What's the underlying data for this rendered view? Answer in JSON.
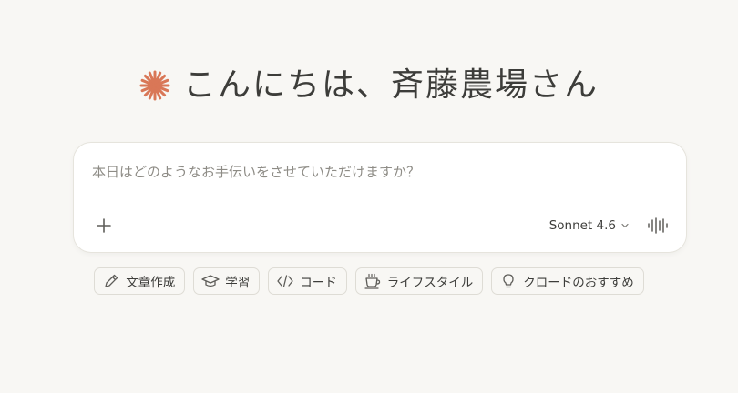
{
  "greeting": {
    "text": "こんにちは、斉藤農場さん",
    "logo_color": "#d97757"
  },
  "composer": {
    "placeholder": "本日はどのようなお手伝いをさせていただけますか？",
    "add_icon": "plus-icon",
    "model_label": "Sonnet 4.6",
    "model_icon": "chevron-down-icon",
    "voice_icon": "voice-waveform-icon"
  },
  "chips": [
    {
      "label": "文章作成",
      "icon": "pencil-icon"
    },
    {
      "label": "学習",
      "icon": "graduation-cap-icon"
    },
    {
      "label": "コード",
      "icon": "code-icon"
    },
    {
      "label": "ライフスタイル",
      "icon": "coffee-cup-icon"
    },
    {
      "label": "クロードのおすすめ",
      "icon": "lightbulb-icon"
    }
  ]
}
